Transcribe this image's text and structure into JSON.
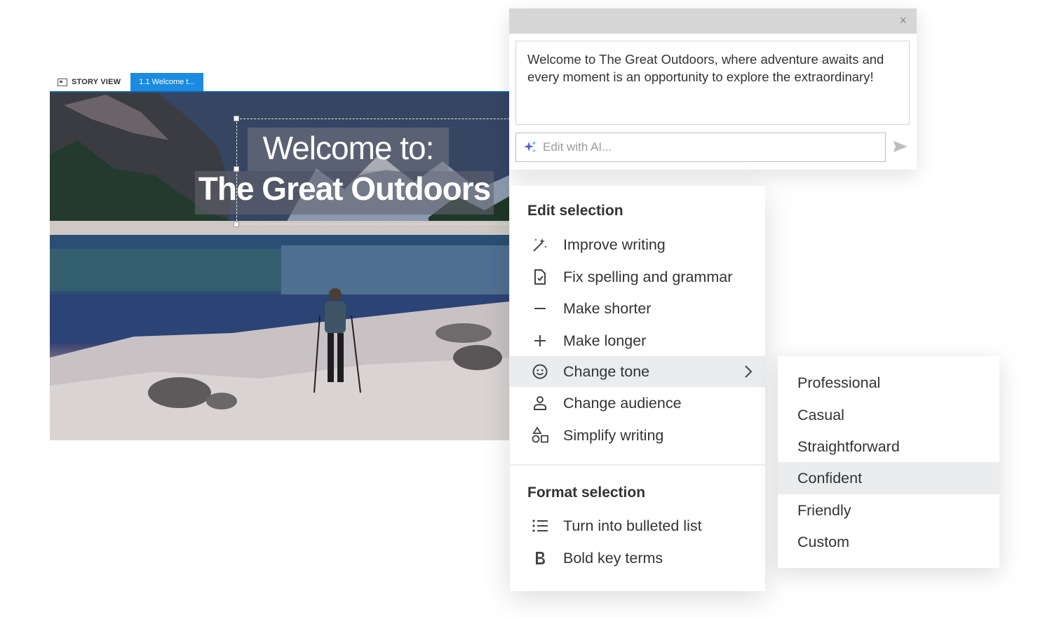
{
  "tabs": {
    "story_view": "STORY VIEW",
    "active_slide": "1.1 Welcome t..."
  },
  "slide": {
    "title_line1": "Welcome to:",
    "title_line2": "The Great Outdoors"
  },
  "ai_panel": {
    "close_icon": "×",
    "text": "Welcome to The Great Outdoors, where adventure awaits and every moment is an opportunity to explore the extraordinary!",
    "input_placeholder": "Edit with AI...",
    "ai_icon": "sparkle-icon",
    "send_icon": "send-icon"
  },
  "menu": {
    "edit_heading": "Edit selection",
    "edit_items": [
      {
        "label": "Improve writing",
        "icon": "magic-wand-icon"
      },
      {
        "label": "Fix spelling and grammar",
        "icon": "document-check-icon"
      },
      {
        "label": "Make shorter",
        "icon": "minus-icon"
      },
      {
        "label": "Make longer",
        "icon": "plus-icon"
      },
      {
        "label": "Change tone",
        "icon": "smiley-icon",
        "has_submenu": true,
        "active": true
      },
      {
        "label": "Change audience",
        "icon": "person-icon"
      },
      {
        "label": "Simplify writing",
        "icon": "shapes-icon"
      }
    ],
    "format_heading": "Format selection",
    "format_items": [
      {
        "label": "Turn into bulleted list",
        "icon": "bulleted-list-icon"
      },
      {
        "label": "Bold key terms",
        "icon": "bold-icon"
      }
    ]
  },
  "tone_submenu": {
    "items": [
      "Professional",
      "Casual",
      "Straightforward",
      "Confident",
      "Friendly",
      "Custom"
    ],
    "highlighted": "Confident"
  },
  "colors": {
    "accent_blue": "#1a8be0",
    "hover_gray": "#eaecee",
    "ai_sparkle": "#5b5bd6"
  }
}
